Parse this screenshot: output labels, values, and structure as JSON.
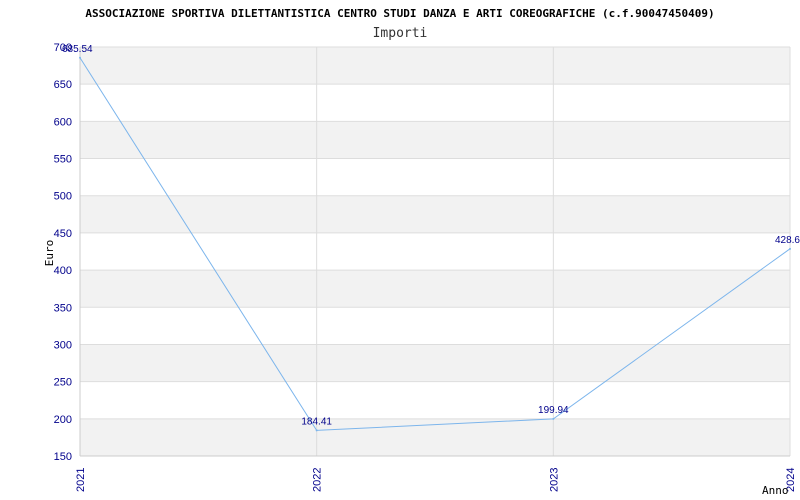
{
  "chart_data": {
    "type": "line",
    "title": "ASSOCIAZIONE SPORTIVA DILETTANTISTICA CENTRO STUDI DANZA E ARTI COREOGRAFICHE (c.f.90047450409)",
    "subtitle": "Importi",
    "xlabel": "Anno",
    "ylabel": "Euro",
    "categories": [
      "2021",
      "2022",
      "2023",
      "2024"
    ],
    "series": [
      {
        "values": [
          685.54,
          184.41,
          199.94,
          428.6
        ],
        "labels": [
          "685.54",
          "184.41",
          "199.94",
          "428.6"
        ]
      }
    ],
    "ylim": [
      150,
      700
    ],
    "yticks": [
      150,
      200,
      250,
      300,
      350,
      400,
      450,
      500,
      550,
      600,
      650,
      700
    ],
    "grid": true,
    "colors": {
      "line": "#7cb5ec",
      "band": "#f2f2f2",
      "grid": "#dddddd",
      "axis": "#cccccc",
      "tick_text": "#00008b"
    }
  }
}
